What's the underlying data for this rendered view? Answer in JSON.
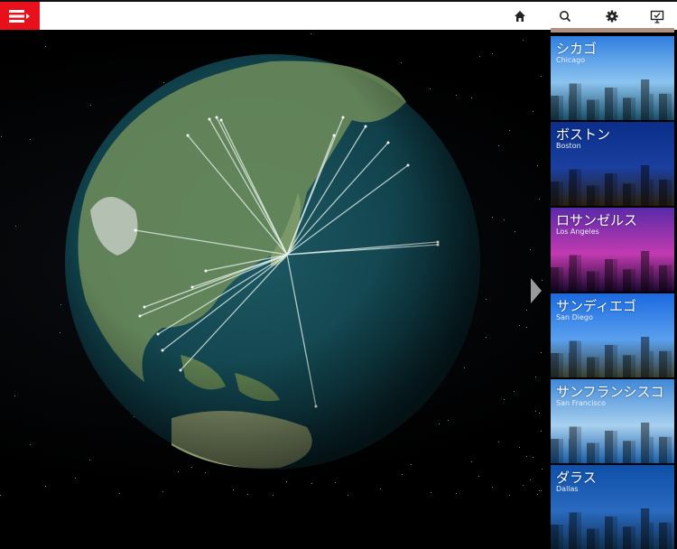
{
  "toolbar": {
    "menu_icon": "menu-icon",
    "icons": [
      "home-icon",
      "search-icon",
      "gear-icon",
      "presentation-icon"
    ]
  },
  "cities": [
    {
      "jp": "シカゴ",
      "en": "Chicago",
      "colors": [
        "#2f7fe0",
        "#8cc4f0",
        "#1a4f6a"
      ]
    },
    {
      "jp": "ボストン",
      "en": "Boston",
      "colors": [
        "#0a2e8a",
        "#1b3f9e",
        "#2a2010"
      ]
    },
    {
      "jp": "ロサンゼルス",
      "en": "Los Angeles",
      "colors": [
        "#5a2aa8",
        "#c23ab0",
        "#1a0830"
      ]
    },
    {
      "jp": "サンディエゴ",
      "en": "San Diego",
      "colors": [
        "#1a6ae0",
        "#5aa0ef",
        "#3a4030"
      ]
    },
    {
      "jp": "サンフランシスコ",
      "en": "San Francisco",
      "colors": [
        "#3f88d8",
        "#a8d0ef",
        "#1a5ea8"
      ]
    },
    {
      "jp": "ダラス",
      "en": "Dallas",
      "colors": [
        "#0e4fa8",
        "#2a6ac0",
        "#103050"
      ]
    }
  ]
}
